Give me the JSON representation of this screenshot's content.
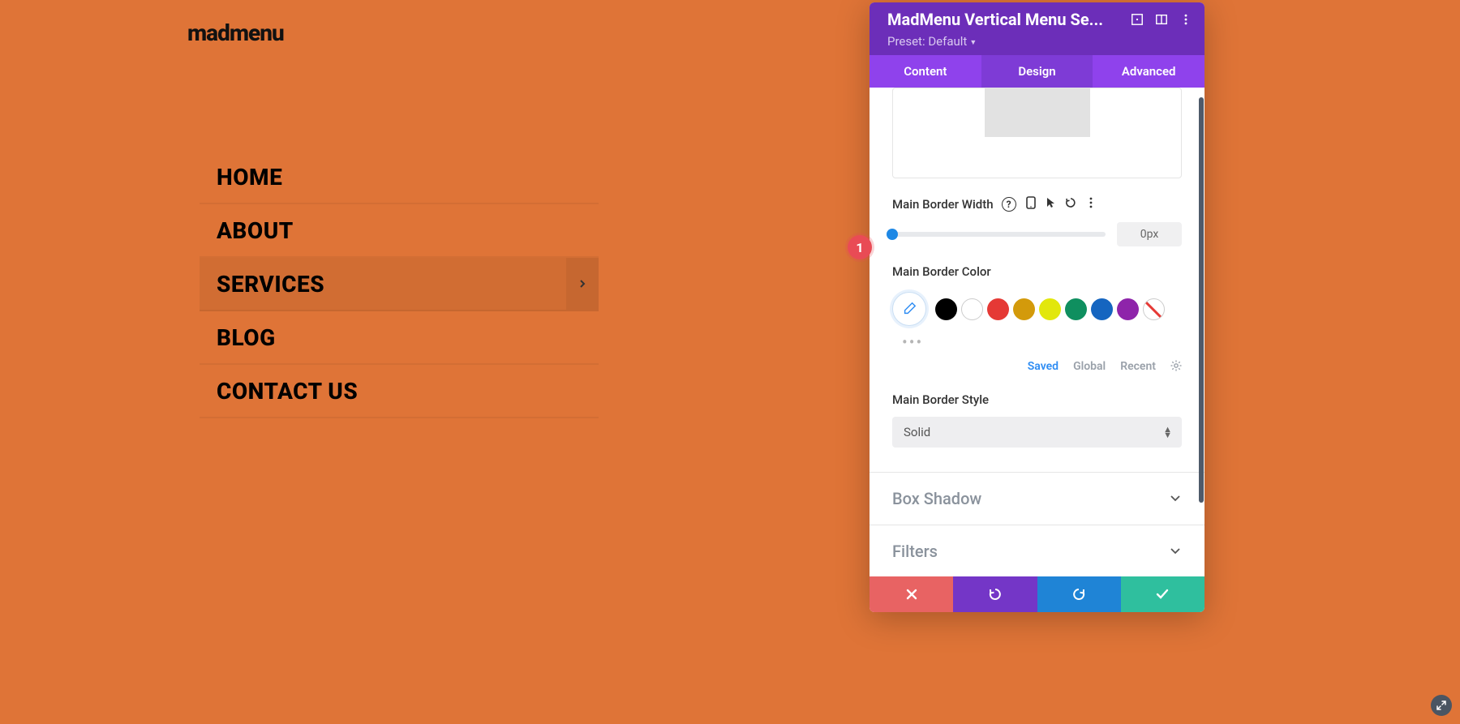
{
  "preview": {
    "logo": "madmenu",
    "menu_items": [
      "HOME",
      "ABOUT",
      "SERVICES",
      "BLOG",
      "CONTACT US"
    ],
    "active_item_index": 2
  },
  "panel": {
    "title": "MadMenu Vertical Menu Se...",
    "preset_text": "Preset: Default",
    "tabs": {
      "content": "Content",
      "design": "Design",
      "advanced": "Advanced",
      "active": "design"
    },
    "settings": {
      "border_width_label": "Main Border Width",
      "border_width_value": "0px",
      "border_color_label": "Main Border Color",
      "swatch_tabs": {
        "saved": "Saved",
        "global": "Global",
        "recent": "Recent"
      },
      "border_style_label": "Main Border Style",
      "border_style_value": "Solid",
      "box_shadow_label": "Box Shadow",
      "filters_label": "Filters"
    },
    "colors": {
      "black": "#000000",
      "white": "#ffffff",
      "red": "#e53935",
      "orange": "#d39a0b",
      "yellow": "#e2e70c",
      "teal": "#0f8f5f",
      "blue": "#1565c0",
      "purple": "#8e24aa"
    }
  },
  "badge": {
    "text": "1"
  }
}
